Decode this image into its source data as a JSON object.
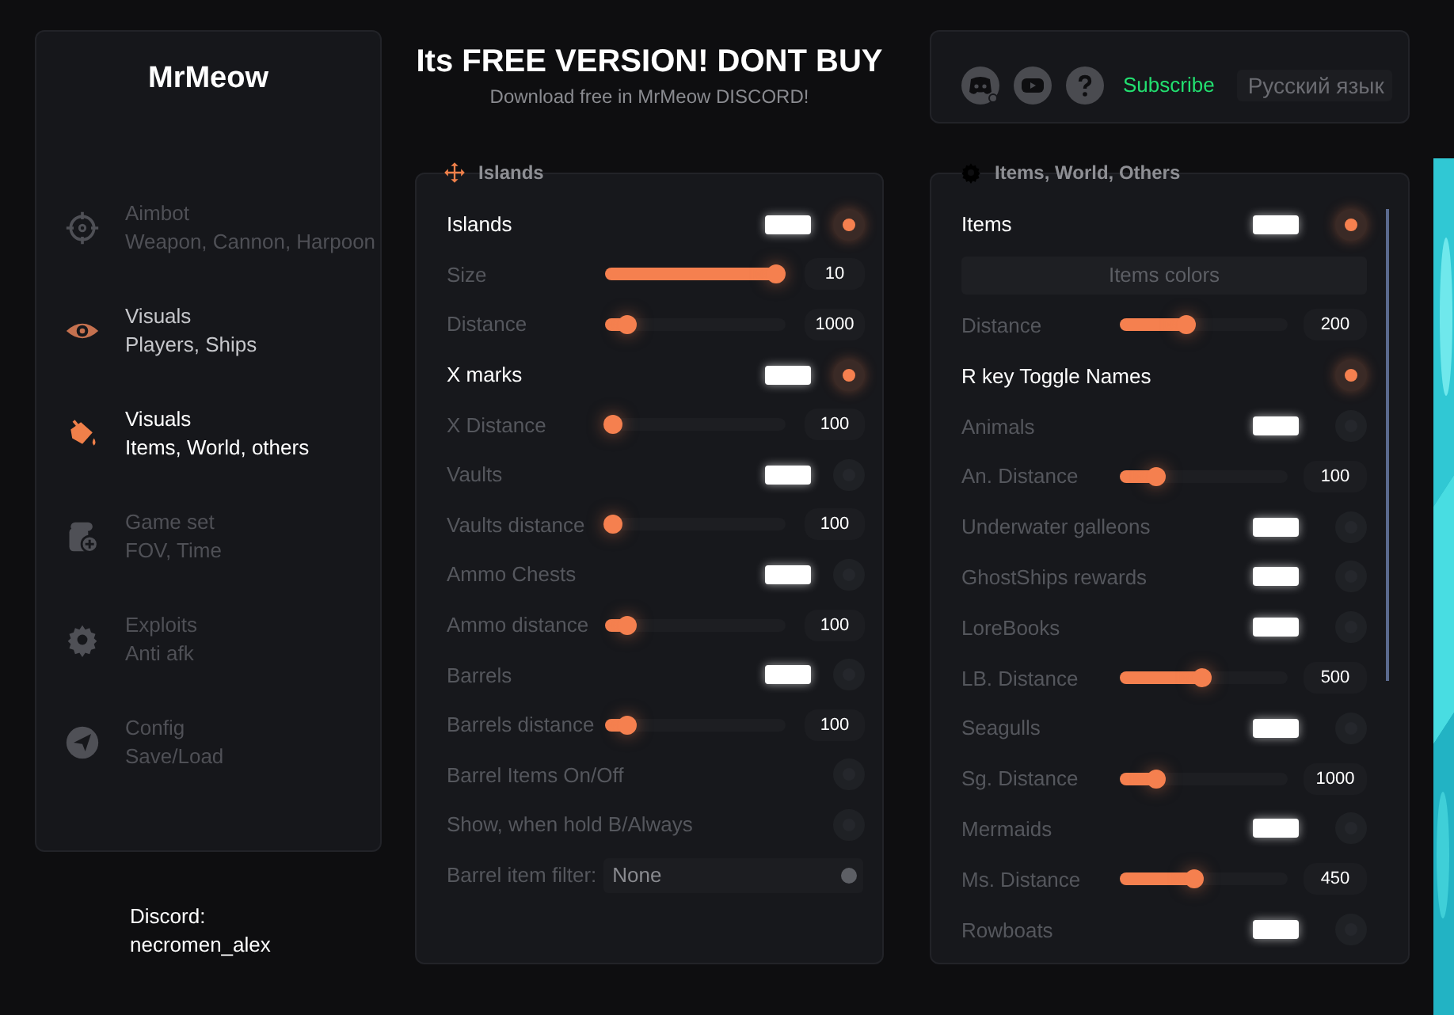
{
  "sidebar": {
    "title": "MrMeow",
    "items": [
      {
        "title": "Aimbot",
        "subtitle": "Weapon, Cannon, Harpoon",
        "selected": false,
        "hovered": false
      },
      {
        "title": "Visuals",
        "subtitle": "Players, Ships",
        "selected": false,
        "hovered": true
      },
      {
        "title": "Visuals",
        "subtitle": "Items, World, others",
        "selected": true,
        "hovered": false
      },
      {
        "title": "Game set",
        "subtitle": "FOV, Time",
        "selected": false,
        "hovered": false
      },
      {
        "title": "Exploits",
        "subtitle": "Anti afk",
        "selected": false,
        "hovered": false
      },
      {
        "title": "Config",
        "subtitle": "Save/Load",
        "selected": false,
        "hovered": false
      }
    ],
    "footer_label": "Discord:",
    "footer_value": "necromen_alex"
  },
  "header": {
    "title": "Its FREE VERSION! DONT BUY",
    "subtitle": "Download free in MrMeow DISCORD!"
  },
  "top_bar": {
    "subscribe": "Subscribe",
    "language": "Русский язык"
  },
  "panels": [
    {
      "title": "Islands",
      "rows": [
        {
          "kind": "color_toggle",
          "label": "Islands",
          "on": true
        },
        {
          "kind": "slider",
          "label": "Size",
          "level": 0.95,
          "value": "10"
        },
        {
          "kind": "slider",
          "label": "Distance",
          "level": 0.12,
          "value": "1000"
        },
        {
          "kind": "color_toggle",
          "label": "X marks",
          "on": true
        },
        {
          "kind": "slider",
          "label": "X Distance",
          "level": 0.04,
          "value": "100"
        },
        {
          "kind": "color_toggle",
          "label": "Vaults",
          "on": false
        },
        {
          "kind": "slider",
          "label": "Vaults distance",
          "level": 0.04,
          "value": "100"
        },
        {
          "kind": "color_toggle",
          "label": "Ammo Chests",
          "on": false
        },
        {
          "kind": "slider",
          "label": "Ammo distance",
          "level": 0.12,
          "value": "100"
        },
        {
          "kind": "color_toggle",
          "label": "Barrels",
          "on": false
        },
        {
          "kind": "slider",
          "label": "Barrels distance",
          "level": 0.12,
          "value": "100"
        },
        {
          "kind": "toggle",
          "label": "Barrel Items On/Off",
          "on": false
        },
        {
          "kind": "toggle",
          "label": "Show, when hold B/Always",
          "on": false
        },
        {
          "kind": "select",
          "label": "Barrel item filter:",
          "value": "None"
        }
      ]
    },
    {
      "title": "Items, World, Others",
      "rows": [
        {
          "kind": "color_toggle",
          "label": "Items",
          "on": true
        },
        {
          "kind": "button",
          "label": "Items colors"
        },
        {
          "kind": "slider",
          "label": "Distance",
          "level": 0.4,
          "value": "200"
        },
        {
          "kind": "toggle",
          "label": "R key Toggle Names",
          "on": true
        },
        {
          "kind": "color_toggle",
          "label": "Animals",
          "on": false
        },
        {
          "kind": "slider",
          "label": "An. Distance",
          "level": 0.22,
          "value": "100"
        },
        {
          "kind": "color_toggle",
          "label": "Underwater galleons",
          "on": false
        },
        {
          "kind": "color_toggle",
          "label": "GhostShips rewards",
          "on": false
        },
        {
          "kind": "color_toggle",
          "label": "LoreBooks",
          "on": false
        },
        {
          "kind": "slider",
          "label": "LB. Distance",
          "level": 0.49,
          "value": "500"
        },
        {
          "kind": "color_toggle",
          "label": "Seagulls",
          "on": false
        },
        {
          "kind": "slider",
          "label": "Sg. Distance",
          "level": 0.22,
          "value": "1000"
        },
        {
          "kind": "color_toggle",
          "label": "Mermaids",
          "on": false
        },
        {
          "kind": "slider",
          "label": "Ms. Distance",
          "level": 0.44,
          "value": "450"
        },
        {
          "kind": "color_toggle",
          "label": "Rowboats",
          "on": false
        }
      ]
    }
  ]
}
